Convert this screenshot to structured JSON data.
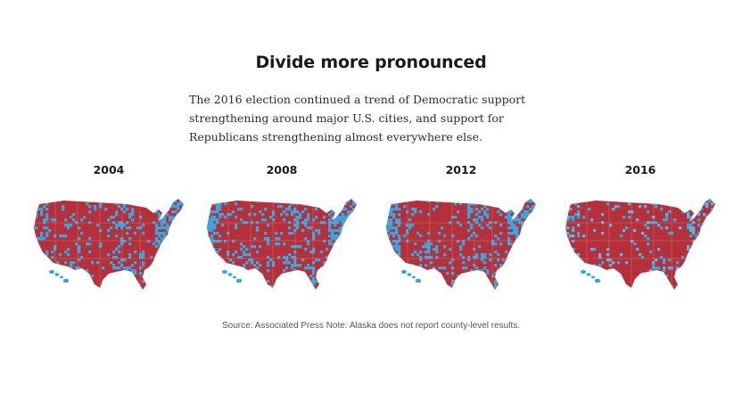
{
  "title": "Divide more pronounced",
  "description": "The 2016 election continued a trend of Democratic support strengthening around major U.S. cities, and support for Republicans strengthening almost everywhere else.",
  "maps": [
    {
      "year": "2004",
      "blue_share": 0.2
    },
    {
      "year": "2008",
      "blue_share": 0.28
    },
    {
      "year": "2012",
      "blue_share": 0.24
    },
    {
      "year": "2016",
      "blue_share": 0.12
    }
  ],
  "colors": {
    "republican": "#b5303a",
    "democratic": "#3aa4dc",
    "democratic_light": "#5fb3e3",
    "border": "#d9a3a7"
  },
  "source": "Source: Associated Press Note: Alaska does not report county-level results."
}
